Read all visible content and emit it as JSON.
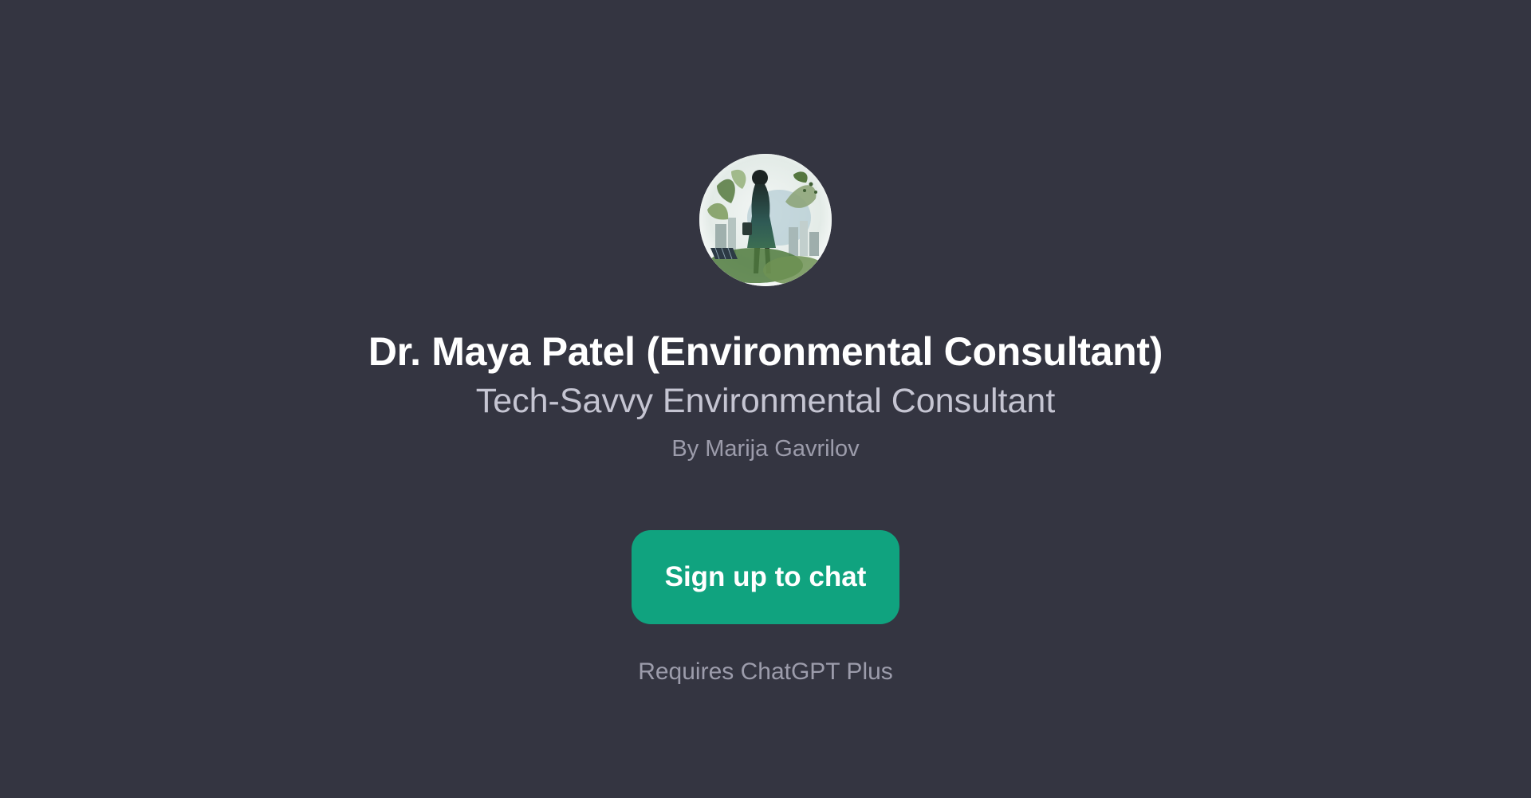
{
  "gpt": {
    "name": "Dr. Maya Patel (Environmental Consultant)",
    "tagline": "Tech-Savvy Environmental Consultant",
    "author": "By Marija Gavrilov"
  },
  "actions": {
    "signup_label": "Sign up to chat",
    "requirement_note": "Requires ChatGPT Plus"
  },
  "colors": {
    "background": "#343541",
    "accent": "#10a37f"
  },
  "icons": {
    "avatar": "environmental-consultant-avatar-image"
  }
}
